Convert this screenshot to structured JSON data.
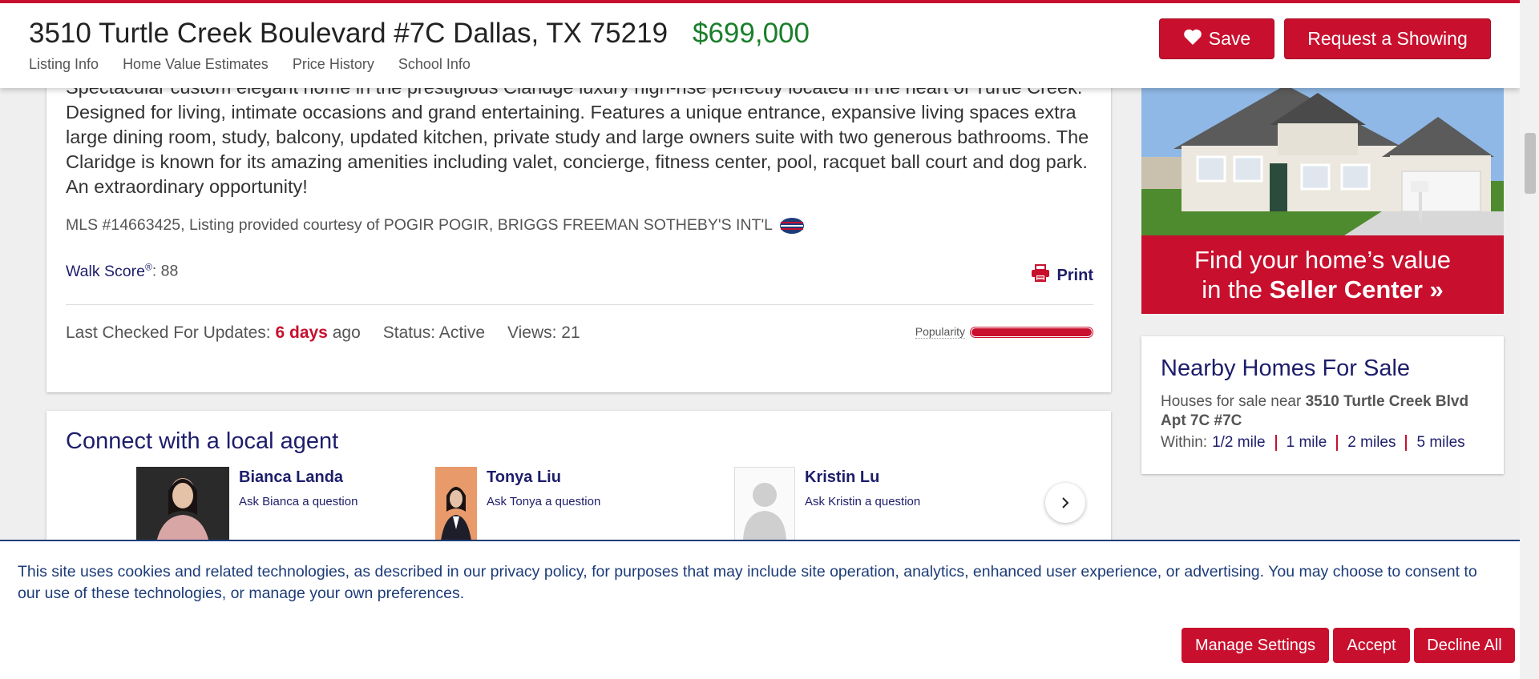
{
  "header": {
    "address": "3510 Turtle Creek Boulevard #7C Dallas, TX 75219",
    "price": "$699,000",
    "nav": [
      "Listing Info",
      "Home Value Estimates",
      "Price History",
      "School Info"
    ],
    "save_label": "Save",
    "request_label": "Request a Showing"
  },
  "description": {
    "text": "Spectacular custom elegant home in the prestigious Claridge luxury high-rise perfectly located in the heart of Turtle Creek. Designed for living, intimate occasions and grand entertaining. Features a unique entrance, expansive living spaces extra large dining room, study, balcony, updated kitchen, private study and large owners suite with two generous bathrooms. The Claridge is known for its amazing amenities including valet, concierge, fitness center, pool, racquet ball court and dog park. An extraordinary opportunity!",
    "mls": "MLS #14663425, Listing provided courtesy of POGIR POGIR, BRIGGS FREEMAN SOTHEBY'S INT'L",
    "walk_label": "Walk Score",
    "walk_reg": "®",
    "walk_value": ": 88",
    "print_label": "Print"
  },
  "status": {
    "checked_label": "Last Checked For Updates:",
    "checked_value": "6 days",
    "checked_suffix": "ago",
    "status": "Status: Active",
    "views": "Views: 21",
    "popularity_label": "Popularity",
    "popularity_fraction": 1.0
  },
  "agents": {
    "title": "Connect with a local agent",
    "list": [
      {
        "name": "Bianca Landa",
        "ask": "Ask Bianca a question"
      },
      {
        "name": "Tonya Liu",
        "ask": "Ask Tonya a question"
      },
      {
        "name": "Kristin Lu",
        "ask": "Ask Kristin a question"
      }
    ]
  },
  "ad": {
    "line1": "Find your home’s value",
    "line2_prefix": "in the",
    "line2_bold": "Seller Center »"
  },
  "nearby": {
    "title": "Nearby Homes For Sale",
    "desc_prefix": "Houses for sale near",
    "desc_bold": "3510 Turtle Creek Blvd Apt 7C #7C",
    "within_label": "Within:",
    "distances": [
      "1/2 mile",
      "1 mile",
      "2 miles",
      "5 miles"
    ]
  },
  "cookie": {
    "text": "This site uses cookies and related technologies, as described in our privacy policy, for purposes that may include site operation, analytics, enhanced user experience, or advertising. You may choose to consent to our use of these technologies, or manage your own preferences.",
    "manage": "Manage Settings",
    "accept": "Accept",
    "decline": "Decline All"
  },
  "colors": {
    "brand_red": "#c8102e",
    "navy": "#1d1d6b",
    "price_green": "#1a7f2b"
  }
}
